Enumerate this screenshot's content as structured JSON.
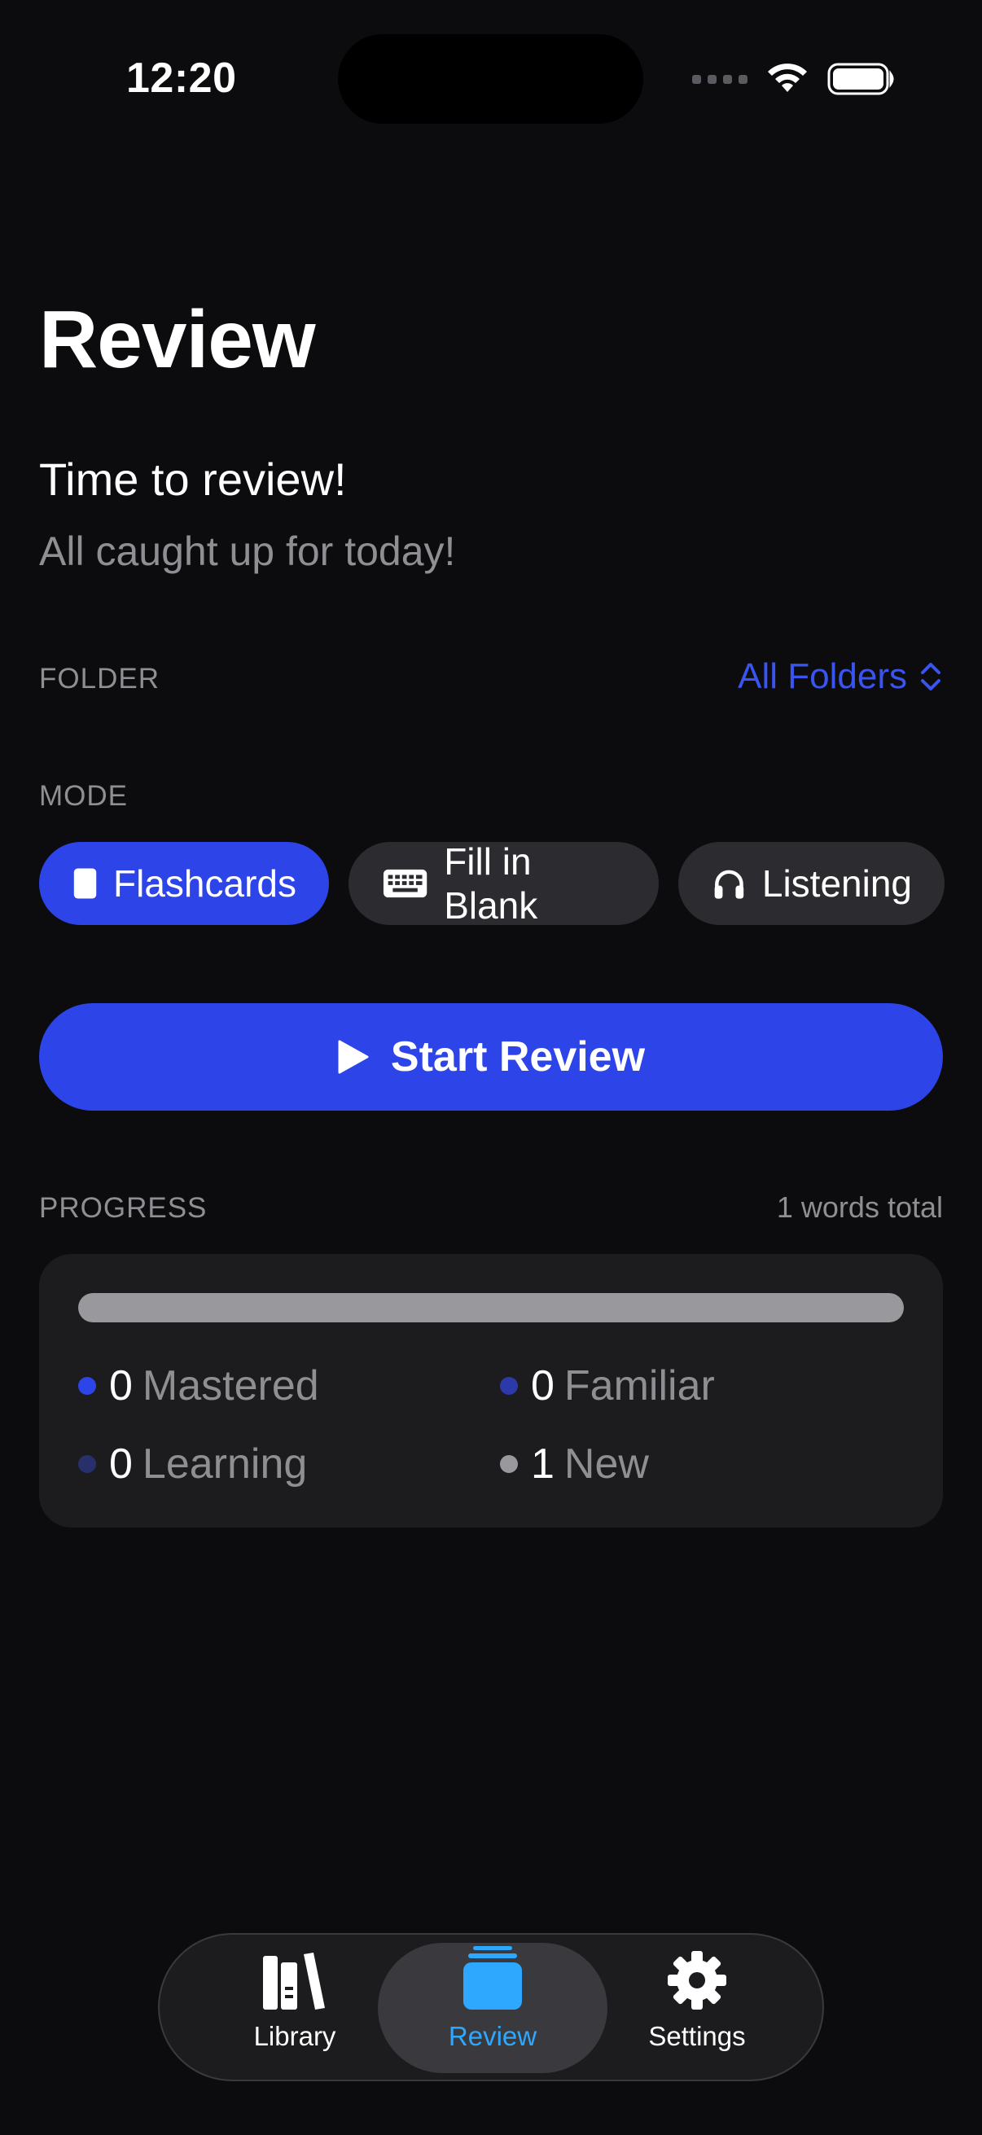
{
  "status_bar": {
    "time": "12:20"
  },
  "header": {
    "title": "Review",
    "subtitle": "Time to review!",
    "caption": "All caught up for today!"
  },
  "folder": {
    "label": "FOLDER",
    "selected": "All Folders"
  },
  "mode": {
    "label": "MODE",
    "options": [
      {
        "label": "Flashcards",
        "icon": "card-icon",
        "selected": true
      },
      {
        "label": "Fill in Blank",
        "icon": "keyboard-icon",
        "selected": false
      },
      {
        "label": "Listening",
        "icon": "headphones-icon",
        "selected": false
      }
    ]
  },
  "start_button": {
    "label": "Start Review",
    "icon": "play-icon"
  },
  "progress": {
    "label": "PROGRESS",
    "total_text": "1 words total",
    "mastered_fraction": 0,
    "stats": [
      {
        "count": "0",
        "label": "Mastered",
        "color": "#2d45e8"
      },
      {
        "count": "0",
        "label": "Familiar",
        "color": "#2b3aa8"
      },
      {
        "count": "0",
        "label": "Learning",
        "color": "#27306b"
      },
      {
        "count": "1",
        "label": "New",
        "color": "#98989d"
      }
    ]
  },
  "tabbar": {
    "items": [
      {
        "label": "Library",
        "icon": "books-icon",
        "active": false
      },
      {
        "label": "Review",
        "icon": "stack-icon",
        "active": true
      },
      {
        "label": "Settings",
        "icon": "gear-icon",
        "active": false
      }
    ]
  },
  "colors": {
    "accent": "#2d45e8",
    "link": "#3a54f0",
    "tab_active": "#2ea8ff",
    "background": "#0c0c0f"
  }
}
